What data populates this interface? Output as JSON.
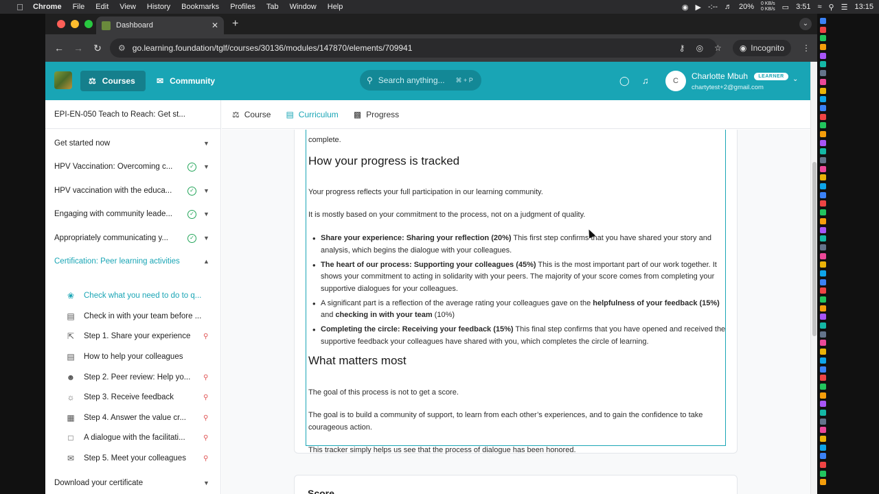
{
  "os_menubar": {
    "app_name": "Chrome",
    "menus": [
      "File",
      "Edit",
      "View",
      "History",
      "Bookmarks",
      "Profiles",
      "Tab",
      "Window",
      "Help"
    ],
    "media_time": "-:--",
    "battery_pct": "20%",
    "net_up": "0 KB/s",
    "net_down": "0 KB/s",
    "battery_time": "3:51",
    "clock": "13:15"
  },
  "browser": {
    "tab_title": "Dashboard",
    "url": "go.learning.foundation/tglf/courses/30136/modules/147870/elements/709941",
    "profile_label": "Incognito"
  },
  "header": {
    "nav": [
      {
        "label": "Courses",
        "icon": "graduation-cap-icon",
        "active": true
      },
      {
        "label": "Community",
        "icon": "chat-bubbles-icon",
        "active": false
      }
    ],
    "search_placeholder": "Search anything...",
    "search_shortcut": "⌘ + P",
    "user": {
      "initial": "C",
      "name": "Charlotte Mbuh",
      "role_badge": "LEARNER",
      "email": "chartytest+2@gmail.com"
    }
  },
  "sidebar": {
    "course_title": "EPI-EN-050 Teach to Reach: Get st...",
    "sections": [
      {
        "label": "Get started now",
        "completed": false
      },
      {
        "label": "HPV Vaccination: Overcoming c...",
        "completed": true
      },
      {
        "label": "HPV vaccination with the educa...",
        "completed": true
      },
      {
        "label": "Engaging with community leade...",
        "completed": true
      },
      {
        "label": "Appropriately communicating y...",
        "completed": true
      },
      {
        "label": "Certification: Peer learning activities",
        "expanded": true
      }
    ],
    "items": [
      {
        "label": "Check what you need to do to q...",
        "icon": "award-icon",
        "locked": false,
        "active": true
      },
      {
        "label": "Check in with your team before ...",
        "icon": "document-icon",
        "locked": false
      },
      {
        "label": "Step 1. Share your experience",
        "icon": "upload-icon",
        "locked": true
      },
      {
        "label": "How to help your colleagues",
        "icon": "document-icon",
        "locked": false
      },
      {
        "label": "Step 2. Peer review: Help yo...",
        "icon": "users-icon",
        "locked": true
      },
      {
        "label": "Step 3. Receive feedback",
        "icon": "lightbulb-icon",
        "locked": true
      },
      {
        "label": "Step 4. Answer the value cr...",
        "icon": "form-icon",
        "locked": true
      },
      {
        "label": "A dialogue with the facilitati...",
        "icon": "message-icon",
        "locked": true
      },
      {
        "label": "Step 5. Meet your colleagues",
        "icon": "chat-icon",
        "locked": true
      }
    ],
    "footer_section": "Download your certificate"
  },
  "content_tabs": [
    {
      "label": "Course",
      "icon": "hat-icon"
    },
    {
      "label": "Curriculum",
      "icon": "books-icon",
      "active": true
    },
    {
      "label": "Progress",
      "icon": "chart-icon"
    }
  ],
  "content": {
    "top_fragment": "complete.",
    "heading1": "How your progress is tracked",
    "p1": "Your progress reflects your full participation in our learning community.",
    "p2": "It is mostly based on your commitment to the process, not on a judgment of quality.",
    "bullets": [
      {
        "bold": "Share your experience: Sharing your reflection (20%)",
        "rest": " This first step confirms that you have shared your story and analysis, which begins the dialogue with your colleagues."
      },
      {
        "bold": "The heart of our process: Supporting your colleagues (45%)",
        "rest": " This is the most important part of our work together. It shows your commitment to acting in solidarity with your peers. The majority of your score comes from completing your supportive dialogues for your colleagues."
      },
      {
        "pre": "A significant part is a reflection of the average rating your colleagues gave on the ",
        "bold": "helpfulness of your feedback (15%)",
        "mid": " and ",
        "bold2": "checking in with your team",
        "rest": " (10%)"
      },
      {
        "bold": "Completing the circle: Receiving your feedback (15%)",
        "rest": " This final step confirms that you have opened and received the supportive feedback your colleagues have shared with you, which completes the circle of learning."
      }
    ],
    "heading2": "What matters most",
    "p3": "The goal of this process is not to get a score.",
    "p4": "The goal is to build a community of support, to learn from each other’s experiences, and to gain the confidence to take courageous action.",
    "p5": "This tracker simply helps us see that the process of dialogue has been honored.",
    "next_card_title": "Score"
  },
  "colors": {
    "brand": "#19a5b5",
    "brand_dark": "#157f8c",
    "complete_green": "#22a559",
    "lock_red": "#e05252"
  }
}
